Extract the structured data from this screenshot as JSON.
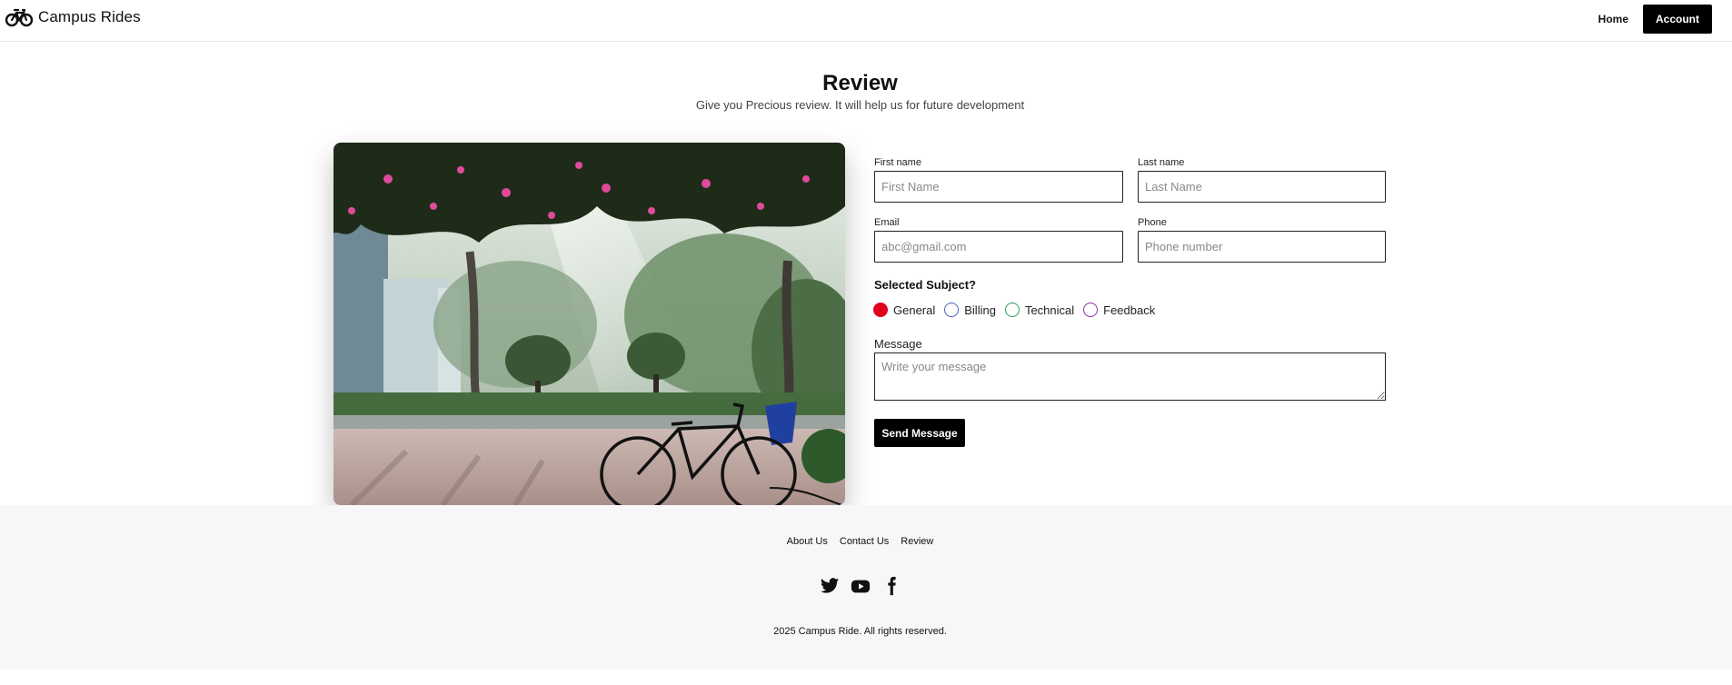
{
  "brand": {
    "name": "Campus Rides",
    "icon": "bicycle-icon"
  },
  "nav": {
    "home": "Home",
    "account": "Account"
  },
  "page": {
    "title": "Review",
    "subtitle": "Give you Precious review. It will help us for future development"
  },
  "form": {
    "first_name": {
      "label": "First name",
      "placeholder": "First Name"
    },
    "last_name": {
      "label": "Last name",
      "placeholder": "Last Name"
    },
    "email": {
      "label": "Email",
      "placeholder": "abc@gmail.com"
    },
    "phone": {
      "label": "Phone",
      "placeholder": "Phone number"
    },
    "subject_heading": "Selected Subject?",
    "subjects": [
      {
        "label": "General",
        "color": "#e0001b",
        "selected": true
      },
      {
        "label": "Billing",
        "color": "#4a63c9",
        "selected": false
      },
      {
        "label": "Technical",
        "color": "#2e9a56",
        "selected": false
      },
      {
        "label": "Feedback",
        "color": "#8a2fa8",
        "selected": false
      }
    ],
    "message": {
      "label": "Message",
      "placeholder": "Write your message"
    },
    "send_label": "Send Message"
  },
  "footer": {
    "links": [
      "About Us",
      "Contact Us",
      "Review"
    ],
    "socials": [
      "twitter-icon",
      "youtube-icon",
      "facebook-icon"
    ],
    "copyright": "2025 Campus Ride. All rights reserved."
  }
}
